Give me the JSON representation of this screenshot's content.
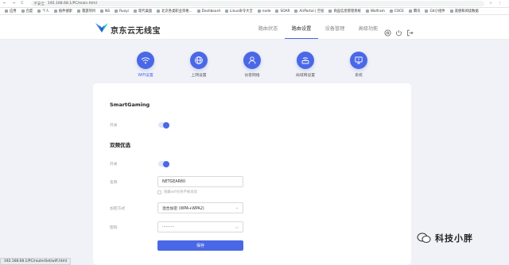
{
  "browser": {
    "nav_icons": "← → C",
    "security_label": "不安全",
    "url": "192.168.68.1/PC/main.html",
    "right_icons": "☆ ⋮"
  },
  "bookmarks": [
    "应用",
    "百度",
    "个人",
    "插件搜索",
    "雷霆项目",
    "NS",
    "Ruoyi",
    "现代桌面",
    "北京各类职业资格...",
    "Dashboard",
    "Linux命令大全",
    "node",
    "SOAR",
    "AirPortal | 空投",
    "商品信息管理系统",
    "Wolfram",
    "COCE",
    "腾讯",
    "Git小组件",
    "遥感和阅读数据"
  ],
  "header": {
    "brand": "京东云无线宝",
    "nav": [
      {
        "label": "路由状态",
        "active": false
      },
      {
        "label": "路由设置",
        "active": true
      },
      {
        "label": "设备管理",
        "active": false
      },
      {
        "label": "高级功能",
        "active": false
      }
    ],
    "icons": [
      "help-icon",
      "power-icon",
      "logout-icon"
    ]
  },
  "categories": [
    {
      "label": "WiFi设置",
      "icon": "wifi-icon",
      "active": true
    },
    {
      "label": "上网设置",
      "icon": "globe-icon",
      "active": false
    },
    {
      "label": "访客网络",
      "icon": "user-icon",
      "active": false
    },
    {
      "label": "局域网设置",
      "icon": "router-icon",
      "active": false
    },
    {
      "label": "系统",
      "icon": "monitor-icon",
      "active": false
    }
  ],
  "form": {
    "section1_title": "SmartGaming",
    "section1_switch_label": "开关",
    "section2_title": "双频优选",
    "section2_switch_label": "开关",
    "name_label": "名称",
    "name_value": "NETGEAR80",
    "hide_label": "隐藏wifi名称不被发现",
    "encrypt_label": "加密方式",
    "encrypt_value": "混合加密 (WPA+WPA2)",
    "password_label": "密码",
    "password_value": "··········",
    "save_label": "保存"
  },
  "status_bar": "192.168.68.1/PC/routerSet/wifi.html",
  "watermark": "科技小胖",
  "colors": {
    "accent": "#4a68e6"
  }
}
